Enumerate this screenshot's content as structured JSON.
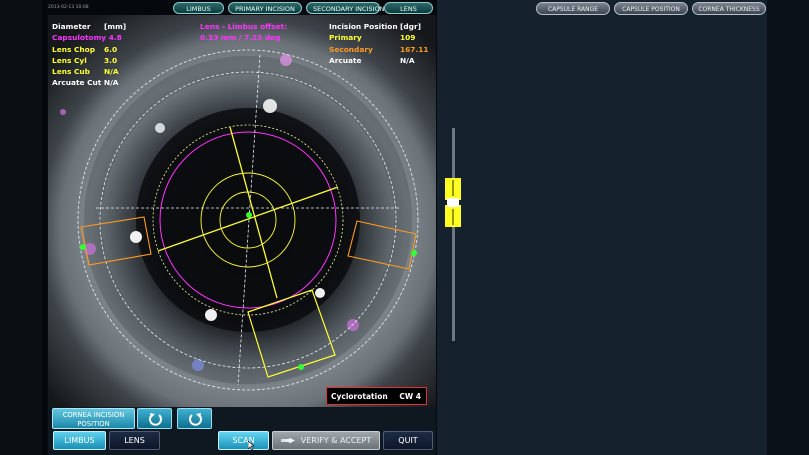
{
  "timestamp": "2013-02-13 10:08",
  "top_tabs": [
    "LIMBUS",
    "PRIMARY INCISION",
    "SECONDARY INCISION",
    "LENS"
  ],
  "right_tabs": [
    "CAPSULE RANGE",
    "CAPSULE POSITION",
    "CORNEA THICKNESS"
  ],
  "overlay": {
    "left": {
      "header": {
        "label": "Diameter",
        "value": "[mm]"
      },
      "rows": [
        {
          "label": "Capsulotomy",
          "value": "4.8"
        },
        {
          "label": "Lens Chop",
          "value": "6.0"
        },
        {
          "label": "Lens Cyl",
          "value": "3.0"
        },
        {
          "label": "Lens Cub",
          "value": "N/A"
        },
        {
          "label": "Arcuate Cut",
          "value": "N/A"
        }
      ]
    },
    "center": {
      "line1": "Lens - Limbus offset:",
      "line2": "0.33 mm / 7.23 deg"
    },
    "right": {
      "header": {
        "label": "Incision Position",
        "value": "[dgr]"
      },
      "rows": [
        {
          "label": "Primary",
          "value": "109"
        },
        {
          "label": "Secondary",
          "value": "167.11"
        },
        {
          "label": "Arcuate",
          "value": "N/A"
        }
      ]
    }
  },
  "cyclorotation": {
    "label": "Cyclorotation",
    "value": "CW 4"
  },
  "buttons": {
    "cornea_line1": "CORNEA INCISION",
    "cornea_line2": "POSITION",
    "limbus": "LIMBUS",
    "lens": "LENS",
    "scan": "SCAN",
    "verify": "VERIFY & ACCEPT",
    "quit": "QUIT"
  },
  "colors": {
    "capsulotomy": "#ff33ff",
    "lens": "#ffff33",
    "incision": "#ff9a22",
    "alert": "#e03030"
  },
  "icons": [
    "rotate-ccw-icon",
    "rotate-cw-icon",
    "cursor-icon"
  ]
}
